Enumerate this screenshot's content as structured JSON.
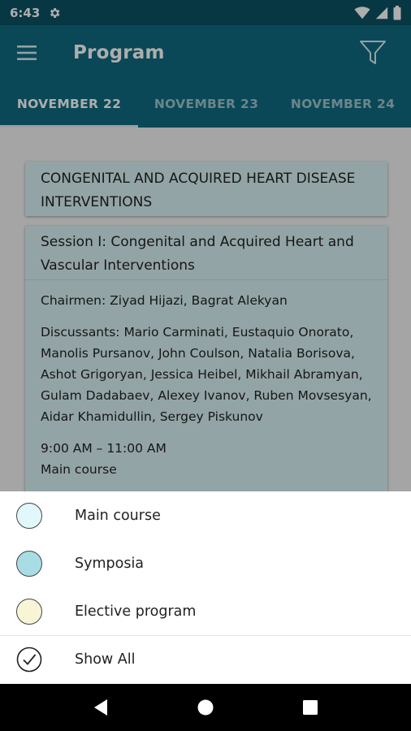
{
  "status_bar": {
    "time": "6:43"
  },
  "app_bar": {
    "title": "Program"
  },
  "tabs": [
    {
      "label": "NOVEMBER 22",
      "active": true
    },
    {
      "label": "NOVEMBER 23",
      "active": false
    },
    {
      "label": "NOVEMBER 24",
      "active": false
    }
  ],
  "program": {
    "section_header": "CONGENITAL AND ACQUIRED HEART DISEASE INTERVENTIONS",
    "session": {
      "title": "Session I: Congenital and Acquired Heart and Vascular Interventions",
      "chairmen": "Chairmen: Ziyad Hijazi, Bagrat Alekyan",
      "discussants": "Discussants: Mario Carminati, Eustaquio Onorato, Manolis Pursanov, John Coulson, Natalia Borisova, Ashot Grigoryan, Jessica Heibel, Mikhail Abramyan, Gulam Dadabaev, Alexey Ivanov, Ruben Movsesyan, Aidar Khamidullin, Sergey Piskunov",
      "time": "9:00 AM – 11:00 AM",
      "type": "Main course"
    }
  },
  "filter_sheet": {
    "options": [
      {
        "label": "Main course",
        "color": "#e1f7fa"
      },
      {
        "label": "Symposia",
        "color": "#a8dde6"
      },
      {
        "label": "Elective program",
        "color": "#f8f4d6"
      }
    ],
    "show_all_label": "Show All"
  },
  "colors": {
    "status_bar": "#0b5263",
    "app_bar": "#0f6b80",
    "card": "#d9f2f5"
  },
  "icons": {
    "menu": "menu-icon",
    "filter": "filter-icon",
    "settings": "gear-icon",
    "back": "back-icon",
    "home": "home-icon",
    "recents": "recents-icon",
    "check": "check-circle-icon"
  }
}
